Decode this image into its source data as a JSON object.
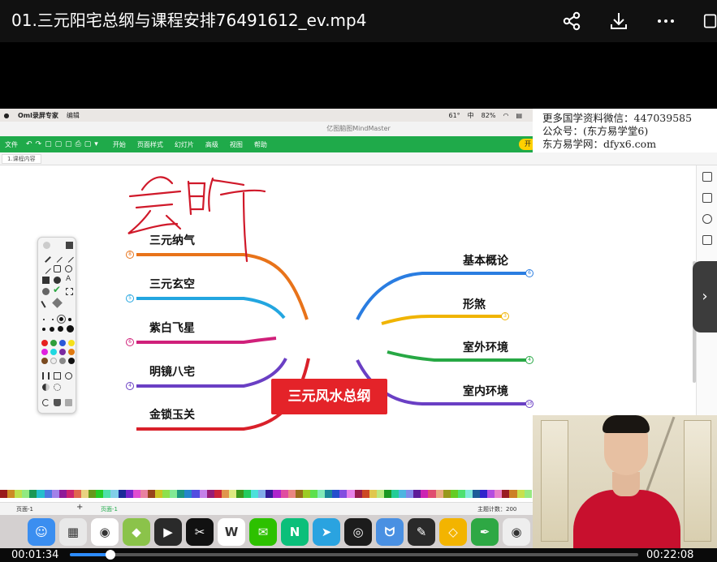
{
  "player": {
    "title": "01.三元阳宅总纲与课程安排76491612_ev.mp4",
    "time_current": "00:01:34",
    "time_total": "00:22:08",
    "progress": 0.071
  },
  "mac_menubar": {
    "app_name": "Oml录屏专家",
    "menu": [
      "编辑"
    ],
    "status": [
      "61°",
      "中",
      "82%"
    ]
  },
  "app": {
    "window_title": "亿图脑图MindMaster",
    "toolbar": [
      "文件",
      "开始",
      "页面样式",
      "幻灯片",
      "高级",
      "视图",
      "帮助"
    ],
    "cta": "开",
    "doc_tab": "1.课程内容",
    "page_tabs": [
      "页面-1",
      "页面-1"
    ],
    "topic_count": "主题计数：200"
  },
  "watermark": {
    "line1": "更多国学资料微信：447039585",
    "line2": "公众号：(东方易学堂6)",
    "line3": "东方易学网：dfyx6.com"
  },
  "handwriting": "会听",
  "mindmap": {
    "center": "三元风水总纲",
    "left": [
      {
        "label": "三元纳气",
        "badge": "8",
        "color": "#e8731a"
      },
      {
        "label": "三元玄空",
        "badge": "5",
        "color": "#23a6e0"
      },
      {
        "label": "紫白飞星",
        "badge": "6",
        "color": "#d0207a"
      },
      {
        "label": "明镜八宅",
        "badge": "4",
        "color": "#6a3fc4"
      },
      {
        "label": "金锁玉关",
        "badge": "",
        "color": "#d9202a"
      }
    ],
    "right": [
      {
        "label": "基本概论",
        "badge": "6",
        "color": "#2a7de1"
      },
      {
        "label": "形煞",
        "badge": "3",
        "color": "#f0b400"
      },
      {
        "label": "室外环境",
        "badge": "4",
        "color": "#27a844"
      },
      {
        "label": "室内环境",
        "badge": "18",
        "color": "#6a3fc4"
      }
    ]
  },
  "dock": [
    {
      "name": "finder",
      "color": "#3b8ef0",
      "glyph": "☺"
    },
    {
      "name": "launchpad",
      "color": "#e8e8e8",
      "glyph": "▦"
    },
    {
      "name": "chrome",
      "color": "#ffffff",
      "glyph": "◉"
    },
    {
      "name": "android",
      "color": "#8bc34a",
      "glyph": "◆"
    },
    {
      "name": "infuse",
      "color": "#2a2a2a",
      "glyph": "▶"
    },
    {
      "name": "capcut",
      "color": "#111111",
      "glyph": "✂"
    },
    {
      "name": "wps",
      "color": "#ffffff",
      "glyph": "W"
    },
    {
      "name": "wechat",
      "color": "#2dc100",
      "glyph": "✉"
    },
    {
      "name": "mindmaster",
      "color": "#0bbf7a",
      "glyph": "N"
    },
    {
      "name": "telegram",
      "color": "#2aa3e0",
      "glyph": "➤"
    },
    {
      "name": "safari-like",
      "color": "#1c1c1c",
      "glyph": "◎"
    },
    {
      "name": "cat",
      "color": "#4a90e2",
      "glyph": "ᗢ"
    },
    {
      "name": "evernote",
      "color": "#2a2a2a",
      "glyph": "✎"
    },
    {
      "name": "notes",
      "color": "#f3b400",
      "glyph": "◇"
    },
    {
      "name": "pen",
      "color": "#2ea844",
      "glyph": "✒"
    },
    {
      "name": "camera",
      "color": "#eeeeee",
      "glyph": "◉"
    },
    {
      "name": "recorder",
      "color": "#1c1c1c",
      "glyph": "■"
    },
    {
      "name": "trash",
      "color": "#dcdcdc",
      "glyph": "🗑"
    }
  ]
}
